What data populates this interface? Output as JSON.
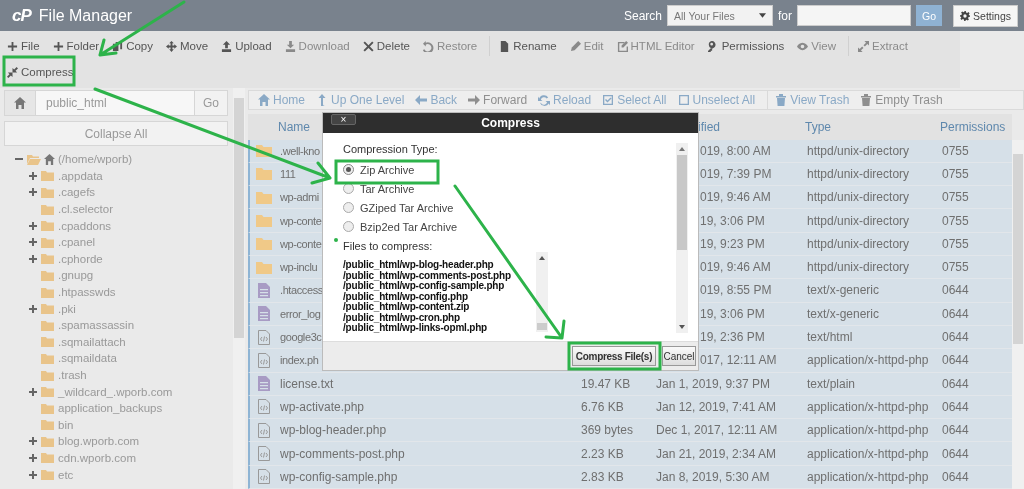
{
  "header": {
    "logo": "cP",
    "title": "File Manager",
    "search_label": "Search",
    "search_scope": "All Your Files",
    "for_label": "for",
    "go": "Go",
    "settings": "Settings"
  },
  "toolbar": [
    {
      "label": "File",
      "disabled": false
    },
    {
      "label": "Folder",
      "disabled": false
    },
    {
      "label": "Copy",
      "disabled": false
    },
    {
      "label": "Move",
      "disabled": false
    },
    {
      "label": "Upload",
      "disabled": false
    },
    {
      "label": "Download",
      "disabled": true
    },
    {
      "label": "Delete",
      "disabled": false
    },
    {
      "label": "Restore",
      "disabled": true
    },
    {
      "label": "Rename",
      "disabled": false
    },
    {
      "label": "Edit",
      "disabled": true
    },
    {
      "label": "HTML Editor",
      "disabled": true
    },
    {
      "label": "Permissions",
      "disabled": false
    },
    {
      "label": "View",
      "disabled": true
    },
    {
      "label": "Extract",
      "disabled": true
    },
    {
      "label": "Compress",
      "disabled": false
    }
  ],
  "sidebar": {
    "path": "public_html",
    "go": "Go",
    "collapse": "Collapse All",
    "tree": [
      {
        "label": "(/home/wporb)",
        "expandable": true,
        "expanded": true,
        "children": [
          {
            "label": ".appdata",
            "expandable": true,
            "expanded": false
          },
          {
            "label": ".cagefs",
            "expandable": true,
            "expanded": false
          },
          {
            "label": ".cl.selector",
            "expandable": false,
            "expanded": false
          },
          {
            "label": ".cpaddons",
            "expandable": true,
            "expanded": false
          },
          {
            "label": ".cpanel",
            "expandable": true,
            "expanded": false
          },
          {
            "label": ".cphorde",
            "expandable": true,
            "expanded": false
          },
          {
            "label": ".gnupg",
            "expandable": false,
            "expanded": false
          },
          {
            "label": ".htpasswds",
            "expandable": false,
            "expanded": false
          },
          {
            "label": ".pki",
            "expandable": true,
            "expanded": false
          },
          {
            "label": ".spamassassin",
            "expandable": false,
            "expanded": false
          },
          {
            "label": ".sqmailattach",
            "expandable": false,
            "expanded": false
          },
          {
            "label": ".sqmaildata",
            "expandable": false,
            "expanded": false
          },
          {
            "label": ".trash",
            "expandable": false,
            "expanded": false
          },
          {
            "label": "_wildcard_.wporb.com",
            "expandable": true,
            "expanded": false
          },
          {
            "label": "application_backups",
            "expandable": false,
            "expanded": false
          },
          {
            "label": "bin",
            "expandable": false,
            "expanded": false
          },
          {
            "label": "blog.wporb.com",
            "expandable": true,
            "expanded": false
          },
          {
            "label": "cdn.wporb.com",
            "expandable": true,
            "expanded": false
          },
          {
            "label": "etc",
            "expandable": true,
            "expanded": false
          }
        ]
      }
    ]
  },
  "nav": [
    {
      "label": "Home",
      "disabled": false
    },
    {
      "label": "Up One Level",
      "disabled": false
    },
    {
      "label": "Back",
      "disabled": false
    },
    {
      "label": "Forward",
      "disabled": true
    },
    {
      "label": "Reload",
      "disabled": false
    },
    {
      "label": "Select All",
      "disabled": false
    },
    {
      "label": "Unselect All",
      "disabled": false
    },
    {
      "label": "View Trash",
      "disabled": false
    },
    {
      "label": "Empty Trash",
      "disabled": true
    }
  ],
  "table": {
    "columns": {
      "name": "Name",
      "modified": "ified",
      "type": "Type",
      "permissions": "Permissions"
    },
    "rows_under_dialog": [
      {
        "kind": "folder",
        "name": ".well-kno",
        "modified": "019, 8:00 AM",
        "type": "httpd/unix-directory",
        "permissions": "0755",
        "selected": true
      },
      {
        "kind": "folder",
        "name": "111",
        "modified": "019, 7:39 PM",
        "type": "httpd/unix-directory",
        "permissions": "0755",
        "selected": true
      },
      {
        "kind": "folder",
        "name": "wp-admi",
        "modified": "019, 9:46 AM",
        "type": "httpd/unix-directory",
        "permissions": "0755",
        "selected": true
      },
      {
        "kind": "folder",
        "name": "wp-conte",
        "modified": "19, 3:06 PM",
        "type": "httpd/unix-directory",
        "permissions": "0755",
        "selected": true
      },
      {
        "kind": "folder",
        "name": "wp-conte",
        "modified": "19, 9:23 PM",
        "type": "httpd/unix-directory",
        "permissions": "0755",
        "selected": true
      },
      {
        "kind": "folder",
        "name": "wp-inclu",
        "modified": "019, 9:46 AM",
        "type": "httpd/unix-directory",
        "permissions": "0755",
        "selected": true
      },
      {
        "kind": "text",
        "name": ".htaccess",
        "modified": "019, 8:55 PM",
        "type": "text/x-generic",
        "permissions": "0644",
        "selected": true
      },
      {
        "kind": "text",
        "name": "error_log",
        "modified": "19, 3:06 PM",
        "type": "text/x-generic",
        "permissions": "0644",
        "selected": true
      },
      {
        "kind": "code",
        "name": "google3c",
        "modified": "19, 2:36 PM",
        "type": "text/html",
        "permissions": "0644",
        "selected": true
      },
      {
        "kind": "code",
        "name": "index.ph",
        "modified": "017, 12:11 AM",
        "type": "application/x-httpd-php",
        "permissions": "0644",
        "selected": true
      }
    ],
    "rows": [
      {
        "kind": "text",
        "name": "license.txt",
        "size": "19.47 KB",
        "modified": "Jan 1, 2019, 9:37 PM",
        "type": "text/plain",
        "permissions": "0644",
        "selected": true
      },
      {
        "kind": "code",
        "name": "wp-activate.php",
        "size": "6.76 KB",
        "modified": "Jan 12, 2019, 7:41 AM",
        "type": "application/x-httpd-php",
        "permissions": "0644",
        "selected": true
      },
      {
        "kind": "code",
        "name": "wp-blog-header.php",
        "size": "369 bytes",
        "modified": "Dec 1, 2017, 12:11 AM",
        "type": "application/x-httpd-php",
        "permissions": "0644",
        "selected": true
      },
      {
        "kind": "code",
        "name": "wp-comments-post.php",
        "size": "2.23 KB",
        "modified": "Jan 21, 2019, 2:34 AM",
        "type": "application/x-httpd-php",
        "permissions": "0644",
        "selected": true
      },
      {
        "kind": "code",
        "name": "wp-config-sample.php",
        "size": "2.83 KB",
        "modified": "Jan 8, 2019, 5:30 AM",
        "type": "application/x-httpd-php",
        "permissions": "0644",
        "selected": true
      }
    ]
  },
  "dialog": {
    "title": "Compress",
    "close": "×",
    "type_label": "Compression Type:",
    "options": [
      {
        "label": "Zip Archive",
        "selected": true
      },
      {
        "label": "Tar Archive",
        "selected": false
      },
      {
        "label": "GZiped Tar Archive",
        "selected": false
      },
      {
        "label": "Bzip2ed Tar Archive",
        "selected": false
      }
    ],
    "files_label": "Files to compress:",
    "files": [
      "/public_html/wp-blog-header.php",
      "/public_html/wp-comments-post.php",
      "/public_html/wp-config-sample.php",
      "/public_html/wp-config.php",
      "/public_html/wp-content.zip",
      "/public_html/wp-cron.php",
      "/public_html/wp-links-opml.php"
    ],
    "buttons": {
      "primary": "Compress File(s)",
      "cancel": "Cancel"
    }
  }
}
